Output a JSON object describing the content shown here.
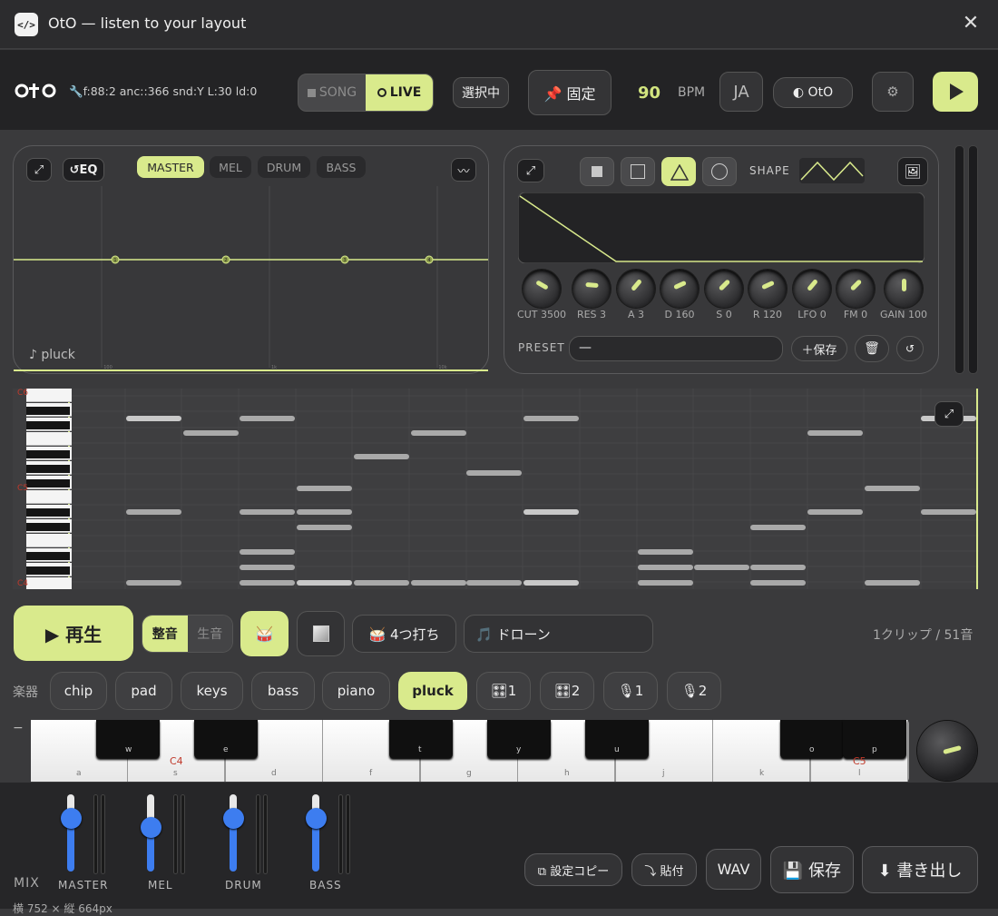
{
  "window": {
    "title": "OtO — listen to your layout",
    "app_icon": "</>",
    "close": "✕"
  },
  "header": {
    "status": "🔧f:88:2 anc::366 snd:Y L:30 ld:0",
    "mode_song": "SONG",
    "mode_live": "LIVE",
    "select": "選択中",
    "pin": "📌 固定",
    "bpm": "90",
    "bpm_label": "BPM",
    "lang": "JA",
    "theme": "◐ OtO",
    "settings": "⚙"
  },
  "eq": {
    "expand": "⤢",
    "eq_button": "↺EQ",
    "tabs": [
      "MASTER",
      "MEL",
      "DRUM",
      "BASS"
    ],
    "active_tab": "MASTER",
    "wave_button": "〰",
    "caption": "♪ pluck",
    "nodes": [
      "1",
      "2",
      "3",
      "4"
    ],
    "axis": [
      "100",
      "1k",
      "10k"
    ]
  },
  "synth": {
    "expand": "⤢",
    "shape_label": "SHAPE",
    "active_shape": "triangle",
    "knobs": [
      "CUT 3500",
      "RES 3",
      "A 3",
      "D 160",
      "S 0",
      "R 120",
      "LFO 0",
      "FM 0",
      "GAIN 100"
    ],
    "preset_label": "PRESET",
    "preset_value": "—",
    "save": "＋保存",
    "trash": "🗑",
    "reset": "↺",
    "image_icon": "🖼"
  },
  "roll": {
    "labels": [
      "C6",
      "C5",
      "C4"
    ],
    "expand": "⤢"
  },
  "transport": {
    "play": "▶ 再生",
    "tuned": "整音",
    "raw": "生音",
    "drum_icon": "🥁",
    "pattern": "🥁 4つ打ち",
    "drone": "🎵 ドローン",
    "summary": "1クリップ / 51音"
  },
  "instruments": {
    "label": "楽器",
    "items": [
      "chip",
      "pad",
      "keys",
      "bass",
      "piano",
      "pluck",
      "🎛1",
      "🎛2",
      "🎙1",
      "🎙2"
    ],
    "active": "pluck"
  },
  "keyboard": {
    "white": [
      "a",
      "s",
      "d",
      "f",
      "g",
      "h",
      "j",
      "k",
      "l"
    ],
    "black": [
      "w",
      "e",
      "t",
      "y",
      "u",
      "o",
      "p"
    ],
    "c4": "C4",
    "c5": "C5",
    "minus": "−"
  },
  "mixer": {
    "label": "MIX",
    "channels": [
      "MASTER",
      "MEL",
      "DRUM",
      "BASS"
    ],
    "levels": [
      0.7,
      0.58,
      0.7,
      0.7
    ]
  },
  "actions": {
    "copy": "⧉ 設定コピー",
    "paste": "⤵ 貼付",
    "wav": "WAV",
    "save": "💾 保存",
    "export": "⬇ 書き出し"
  },
  "footer": {
    "size": "横 752 × 縦 664px"
  },
  "colors": {
    "accent": "#d9ea8c",
    "fader": "#3d7df0",
    "bg": "#3a3a3c"
  }
}
